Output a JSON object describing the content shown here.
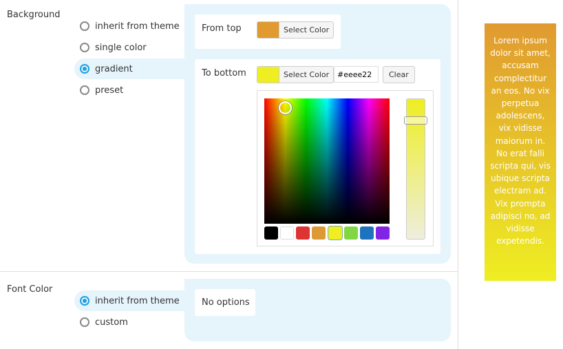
{
  "background": {
    "label": "Background",
    "options": [
      {
        "label": "inherit from theme",
        "selected": false
      },
      {
        "label": "single color",
        "selected": false
      },
      {
        "label": "gradient",
        "selected": true
      },
      {
        "label": "preset",
        "selected": false
      }
    ],
    "from_top": {
      "label": "From top",
      "color": "#e09a30",
      "button": "Select Color"
    },
    "to_bottom": {
      "label": "To bottom",
      "color": "#eeee22",
      "button": "Select Color",
      "hex_value": "#eeee22",
      "clear": "Clear"
    },
    "swatches": [
      "#000000",
      "#ffffff",
      "#dd3333",
      "#dd9933",
      "#eeee22",
      "#81d742",
      "#1e73be",
      "#8224e3"
    ]
  },
  "font_color": {
    "label": "Font Color",
    "options": [
      {
        "label": "inherit from theme",
        "selected": true
      },
      {
        "label": "custom",
        "selected": false
      }
    ],
    "no_options": "No options"
  },
  "preview": {
    "text": "Lorem ipsum dolor sit amet, accusam complectitur an eos. No vix perpetua adolescens, vix vidisse maiorum in. No erat falli scripta qui, vis ubique scripta electram ad. Vix prompta adipisci no, ad vidisse expetendis.",
    "gradient_top": "#e09a30",
    "gradient_bottom": "#eeee22"
  }
}
